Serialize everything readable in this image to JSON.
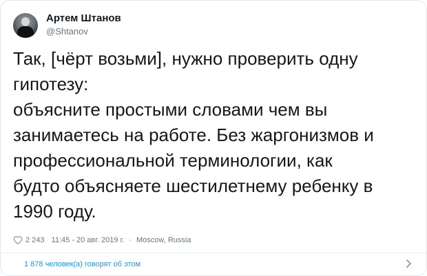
{
  "author": {
    "name": "Артем Штанов",
    "handle": "@Shtanov"
  },
  "tweet": {
    "lines": [
      "Так, [чёрт возьми], нужно проверить одну",
      "гипотезу:",
      "объясните простыми словами чем вы",
      "занимаетесь на работе. Без жаргонизмов и",
      "профессиональной терминологии, как",
      "будто объясняете шестилетнему ребенку в",
      "1990 году."
    ]
  },
  "meta": {
    "likes": "2 243",
    "time": "11:45 - 20 авг. 2019 г.",
    "separator": "·",
    "location": "Moscow, Russia"
  },
  "footer": {
    "replies_text": "1 878 человек(а) говорят об этом"
  },
  "colors": {
    "text": "#14171a",
    "secondary": "#657786",
    "link": "#1b95e0",
    "border": "#e1e8ed"
  },
  "icons": {
    "like": "heart-outline-icon",
    "more": "chevron-right-icon"
  }
}
